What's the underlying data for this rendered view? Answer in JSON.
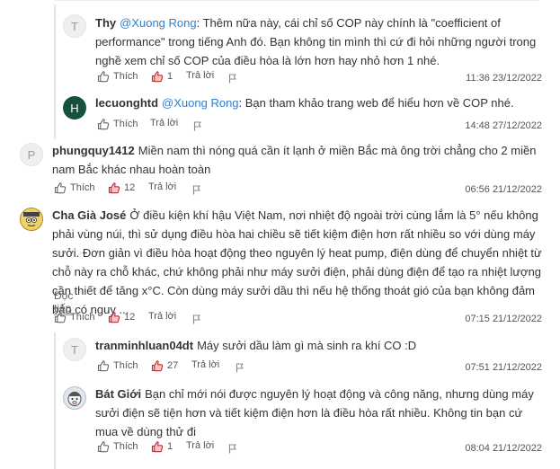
{
  "comments": [
    {
      "avatar_letter": "T",
      "name": "Thy",
      "mention": "@Xuong Rong",
      "text": ": Thêm nữa này, cái chỉ số COP này chính là \"coefficient of performance\" trong tiếng Anh đó. Bạn không tin mình thì cứ đi hỏi những người trong nghề xem chỉ số COP của điều hòa là lớn hơn hay nhỏ hơn 1 nhé.",
      "like_label": "Thích",
      "like_count": "1",
      "reply_label": "Trả lời",
      "time": "11:36 23/12/2022"
    },
    {
      "avatar_letter": "H",
      "name": "lecuonghtd",
      "mention": "@Xuong Rong",
      "text": ": Bạn tham khảo trang web để hiểu hơn về COP nhé.",
      "like_label": "Thích",
      "reply_label": "Trả lời",
      "time": "14:48 27/12/2022"
    },
    {
      "avatar_letter": "P",
      "name": "phungquy1412",
      "text": "Miền nam thì nóng quá cần ít lạnh ở miền Bắc mà ông trời chẳng cho 2 miền nam Bắc khác nhau hoàn toàn",
      "like_label": "Thích",
      "like_count": "12",
      "reply_label": "Trả lời",
      "time": "06:56 21/12/2022"
    },
    {
      "name": "Cha Già José",
      "text": "Ở điều kiện khí hậu Việt Nam, nơi nhiệt độ ngoài trời cùng lắm là 5° nếu không phải vùng núi, thì sử dụng điều hòa hai chiều sẽ tiết kiệm điện hơn rất nhiều so với dùng máy sưởi. Đơn giản vì điều hòa hoạt động theo nguyên lý heat pump, điện dùng để chuyển nhiệt từ chỗ này ra chỗ khác, chứ không phải như máy sưởi điện, phải dùng điện để tạo ra nhiệt lượng cần thiết để tăng x°C. Còn dùng máy sưởi dầu thì nếu hệ thống thoát gió của bạn không đảm bảo có nguy ...",
      "read_more": "Đọc tiếp",
      "like_label": "Thích",
      "like_count": "12",
      "reply_label": "Trả lời",
      "time": "07:15 21/12/2022"
    },
    {
      "avatar_letter": "T",
      "name": "tranminhluan04dt",
      "text": "Máy sưởi dầu làm gì mà sinh ra khí CO :D",
      "like_label": "Thích",
      "like_count": "27",
      "reply_label": "Trả lời",
      "time": "07:51 21/12/2022"
    },
    {
      "name": "Bát Giới",
      "text": "Bạn chỉ mới nói được nguyên lý hoạt động và công năng, nhưng dùng máy sưởi điện sẽ tiện hơn và tiết kiệm điện hơn là điều hòa rất nhiều. Không tin bạn cứ mua về dùng thử đi",
      "like_label": "Thích",
      "like_count": "1",
      "reply_label": "Trả lời",
      "time": "08:04 21/12/2022"
    }
  ],
  "colors": {
    "like_red": "#c62828",
    "mention": "#2f7fd6",
    "muted": "#555555"
  }
}
